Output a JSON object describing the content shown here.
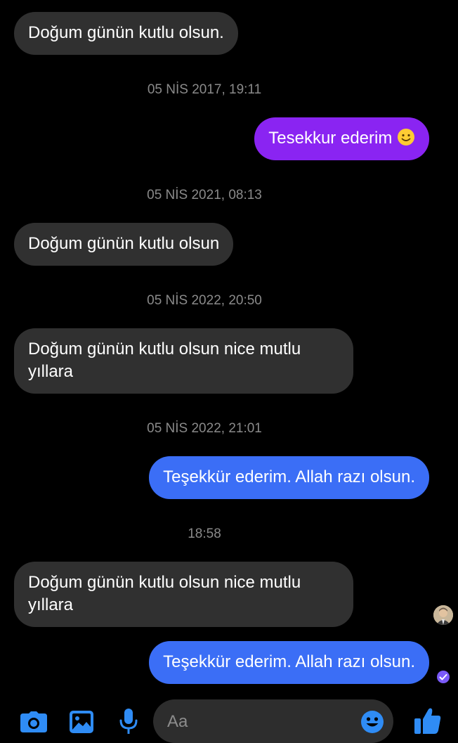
{
  "messages": [
    {
      "side": "incoming",
      "text": "Doğum günün kutlu olsun."
    },
    {
      "timestamp": "05 NİS 2017, 19:11"
    },
    {
      "side": "outgoing",
      "text": "Tesekkur ederim",
      "emoji": "slightly-smiling-face"
    },
    {
      "timestamp": "05 NİS 2021, 08:13"
    },
    {
      "side": "incoming",
      "text": "Doğum günün kutlu olsun"
    },
    {
      "timestamp": "05 NİS 2022, 20:50"
    },
    {
      "side": "incoming",
      "text_line1": "Doğum günün kutlu olsun nice mutlu",
      "text_line2": "yıllara"
    },
    {
      "timestamp": "05 NİS 2022, 21:01"
    },
    {
      "side": "outgoing",
      "text": "Teşekkür ederim. Allah razı olsun."
    },
    {
      "timestamp": "18:58"
    },
    {
      "side": "incoming",
      "text_line1": "Doğum günün kutlu olsun nice mutlu",
      "text_line2": "yıllara"
    },
    {
      "side": "outgoing",
      "text": "Teşekkür ederim. Allah razı olsun."
    }
  ],
  "composer": {
    "placeholder": "Aa",
    "icons": [
      "camera-icon",
      "gallery-icon",
      "microphone-icon",
      "emoji-icon",
      "thumbs-up-icon"
    ]
  },
  "colors": {
    "background": "#000000",
    "incoming_bubble": "#303030",
    "outgoing_bubble_purple": "#8a24f2",
    "outgoing_bubble_blue": "#3b6ef6",
    "timestamp_text": "#8a8a8a",
    "icon_accent": "#2f8cf5",
    "read_check": "#7a5af8"
  }
}
